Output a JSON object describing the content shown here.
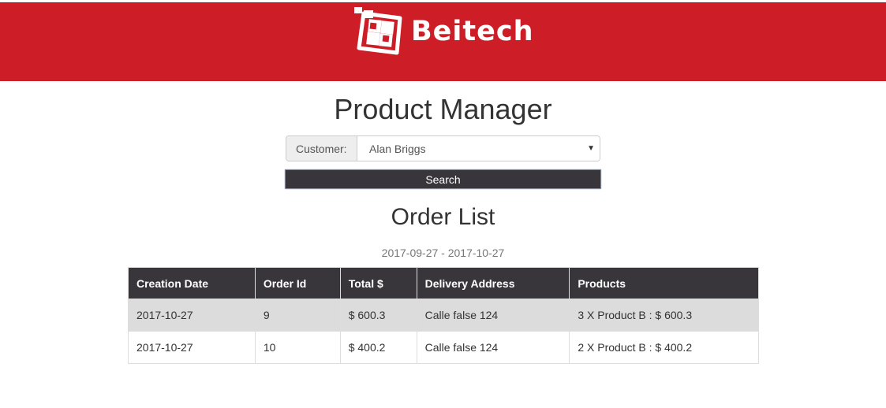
{
  "header": {
    "brand_name": "Beitech",
    "background_color": "#cd1e27",
    "logo_icon": "beitech-logo-icon"
  },
  "page_title": "Product Manager",
  "customer_filter": {
    "label": "Customer:",
    "selected": "Alan Briggs"
  },
  "search_button": {
    "label": "Search",
    "color": "#38363b"
  },
  "order_list": {
    "title": "Order List",
    "date_range": "2017-09-27 - 2017-10-27",
    "columns": [
      "Creation Date",
      "Order Id",
      "Total $",
      "Delivery Address",
      "Products"
    ],
    "rows": [
      [
        "2017-10-27",
        "9",
        "$ 600.3",
        "Calle false 124",
        "3 X Product B : $ 600.3"
      ],
      [
        "2017-10-27",
        "10",
        "$ 400.2",
        "Calle false 124",
        "2 X Product B : $ 400.2"
      ]
    ]
  }
}
